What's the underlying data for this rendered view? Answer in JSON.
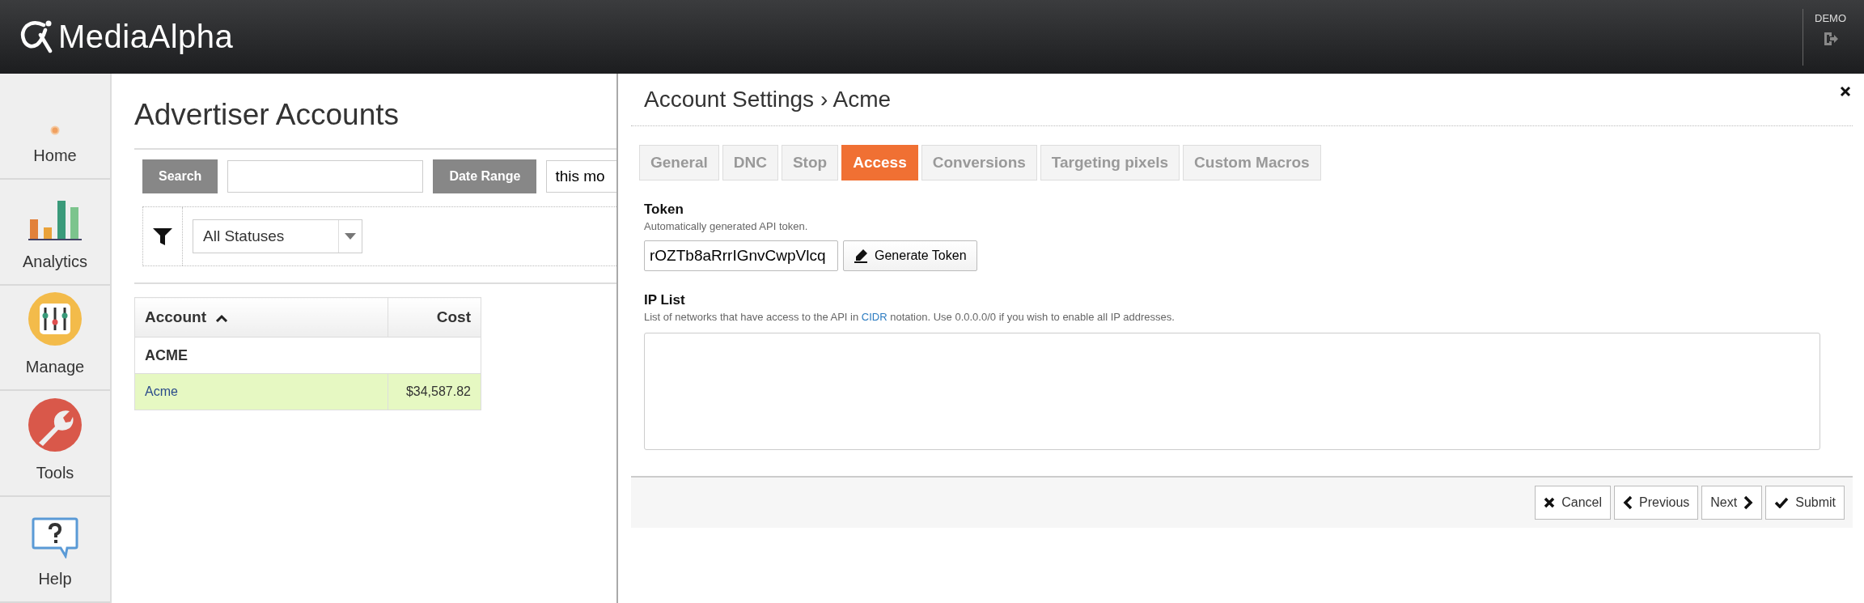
{
  "header": {
    "logo": "MediaAlpha",
    "user": "DEMO"
  },
  "sidebar": {
    "items": [
      {
        "label": "Home",
        "kind": "home"
      },
      {
        "label": "Analytics",
        "kind": "analytics"
      },
      {
        "label": "Manage",
        "kind": "manage"
      },
      {
        "label": "Tools",
        "kind": "tools"
      },
      {
        "label": "Help",
        "kind": "help"
      }
    ]
  },
  "page": {
    "title": "Advertiser Accounts",
    "search_button": "Search",
    "date_range_button": "Date Range",
    "date_range_field": {
      "value": "this mo"
    },
    "status_filter": {
      "value": "All Statuses"
    },
    "table": {
      "columns": [
        {
          "label": "Account",
          "sorted": true
        },
        {
          "label": "Cost",
          "sorted": false
        }
      ],
      "groups": [
        {
          "name": "ACME",
          "rows": [
            {
              "cells": [
                "Acme",
                "$34,587.82"
              ],
              "selected": true
            }
          ]
        }
      ]
    }
  },
  "modal": {
    "title": "Account Settings › Acme",
    "tabs": [
      {
        "label": "General",
        "selected": false
      },
      {
        "label": "DNC",
        "selected": false
      },
      {
        "label": "Stop",
        "selected": false
      },
      {
        "label": "Access",
        "selected": true
      },
      {
        "label": "Conversions",
        "selected": false
      },
      {
        "label": "Targeting pixels",
        "selected": false
      },
      {
        "label": "Custom Macros",
        "selected": false
      }
    ],
    "token": {
      "label": "Token",
      "help": "Automatically generated API token.",
      "value": "rOZTb8aRrrIGnvCwpVlcq",
      "button": "Generate Token"
    },
    "ip_list": {
      "label": "IP List",
      "help": [
        {
          "kind": "text",
          "text": "List of networks that have access to the API in "
        },
        {
          "kind": "link",
          "text": "CIDR"
        },
        {
          "kind": "text",
          "text": " notation. Use 0.0.0.0/0 if you wish to enable all IP addresses."
        }
      ]
    },
    "buttons": [
      {
        "label": "Cancel",
        "kind": "cancel"
      },
      {
        "label": "Previous",
        "kind": "previous"
      },
      {
        "label": "Next",
        "kind": "next"
      },
      {
        "label": "Submit",
        "kind": "submit"
      }
    ]
  }
}
